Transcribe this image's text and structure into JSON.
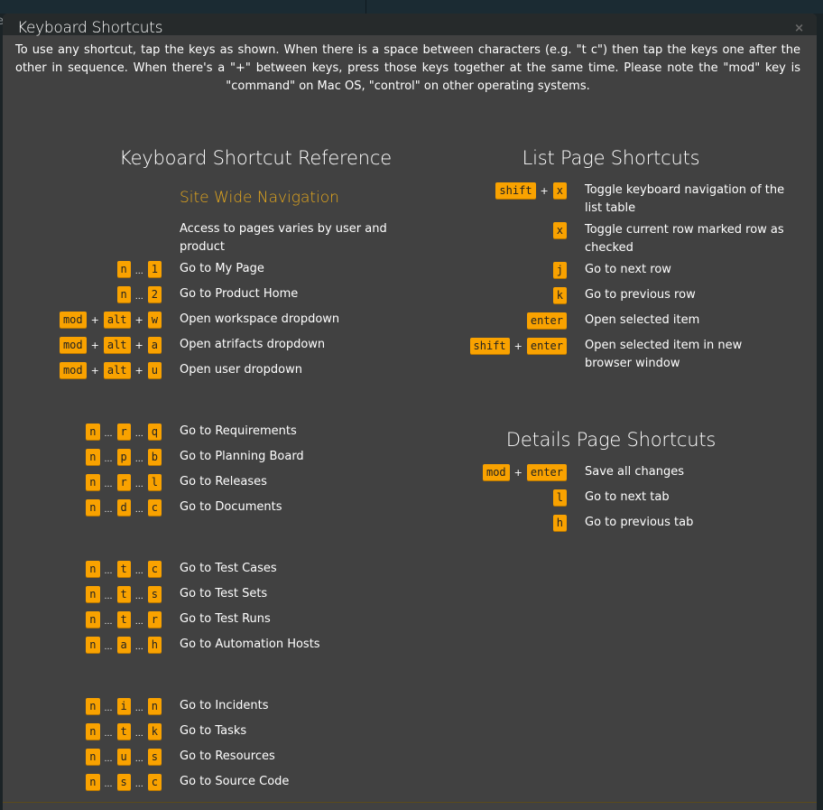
{
  "background": {
    "left_text": "ent"
  },
  "modal": {
    "title": "Keyboard Shortcuts",
    "close_label": "×",
    "intro": "To use any shortcut, tap the keys as shown. When there is a space between characters (e.g. \"t c\") then tap the keys one after the other in sequence. When there's a \"+\" between keys, press those keys together at the same time. Please note the \"mod\" key is \"command\" on Mac OS, \"control\" on other operating systems.",
    "accent_color": "#f9a200"
  },
  "reference": {
    "title": "Keyboard Shortcut Reference",
    "subtitle": "Site Wide Navigation",
    "note": "Access to pages varies by user and product",
    "groups": [
      [
        {
          "keys": [
            "n",
            "1"
          ],
          "joiner": "…",
          "desc": "Go to My Page"
        },
        {
          "keys": [
            "n",
            "2"
          ],
          "joiner": "…",
          "desc": "Go to Product Home"
        },
        {
          "keys": [
            "mod",
            "alt",
            "w"
          ],
          "joiner": "+",
          "desc": "Open workspace dropdown"
        },
        {
          "keys": [
            "mod",
            "alt",
            "a"
          ],
          "joiner": "+",
          "desc": "Open atrifacts dropdown"
        },
        {
          "keys": [
            "mod",
            "alt",
            "u"
          ],
          "joiner": "+",
          "desc": "Open user dropdown"
        }
      ],
      [
        {
          "keys": [
            "n",
            "r",
            "q"
          ],
          "joiner": "…",
          "desc": "Go to Requirements"
        },
        {
          "keys": [
            "n",
            "p",
            "b"
          ],
          "joiner": "…",
          "desc": "Go to Planning Board"
        },
        {
          "keys": [
            "n",
            "r",
            "l"
          ],
          "joiner": "…",
          "desc": "Go to Releases"
        },
        {
          "keys": [
            "n",
            "d",
            "c"
          ],
          "joiner": "…",
          "desc": "Go to Documents"
        }
      ],
      [
        {
          "keys": [
            "n",
            "t",
            "c"
          ],
          "joiner": "…",
          "desc": "Go to Test Cases"
        },
        {
          "keys": [
            "n",
            "t",
            "s"
          ],
          "joiner": "…",
          "desc": "Go to Test Sets"
        },
        {
          "keys": [
            "n",
            "t",
            "r"
          ],
          "joiner": "…",
          "desc": "Go to Test Runs"
        },
        {
          "keys": [
            "n",
            "a",
            "h"
          ],
          "joiner": "…",
          "desc": "Go to Automation Hosts"
        }
      ],
      [
        {
          "keys": [
            "n",
            "i",
            "n"
          ],
          "joiner": "…",
          "desc": "Go to Incidents"
        },
        {
          "keys": [
            "n",
            "t",
            "k"
          ],
          "joiner": "…",
          "desc": "Go to Tasks"
        },
        {
          "keys": [
            "n",
            "u",
            "s"
          ],
          "joiner": "…",
          "desc": "Go to Resources"
        },
        {
          "keys": [
            "n",
            "s",
            "c"
          ],
          "joiner": "…",
          "desc": "Go to Source Code"
        }
      ]
    ]
  },
  "list_page": {
    "title": "List Page Shortcuts",
    "items": [
      {
        "keys": [
          "shift",
          "x"
        ],
        "joiner": "+",
        "desc": "Toggle keyboard navigation of the list table"
      },
      {
        "keys": [
          "x"
        ],
        "joiner": "+",
        "desc": "Toggle current row marked row as checked"
      },
      {
        "keys": [
          "j"
        ],
        "joiner": "+",
        "desc": "Go to next row"
      },
      {
        "keys": [
          "k"
        ],
        "joiner": "+",
        "desc": "Go to previous row"
      },
      {
        "keys": [
          "enter"
        ],
        "joiner": "+",
        "desc": "Open selected item"
      },
      {
        "keys": [
          "shift",
          "enter"
        ],
        "joiner": "+",
        "desc": "Open selected item in new browser window"
      }
    ]
  },
  "details_page": {
    "title": "Details Page Shortcuts",
    "items": [
      {
        "keys": [
          "mod",
          "enter"
        ],
        "joiner": "+",
        "desc": "Save all changes"
      },
      {
        "keys": [
          "l"
        ],
        "joiner": "+",
        "desc": "Go to next tab"
      },
      {
        "keys": [
          "h"
        ],
        "joiner": "+",
        "desc": "Go to previous tab"
      }
    ]
  }
}
